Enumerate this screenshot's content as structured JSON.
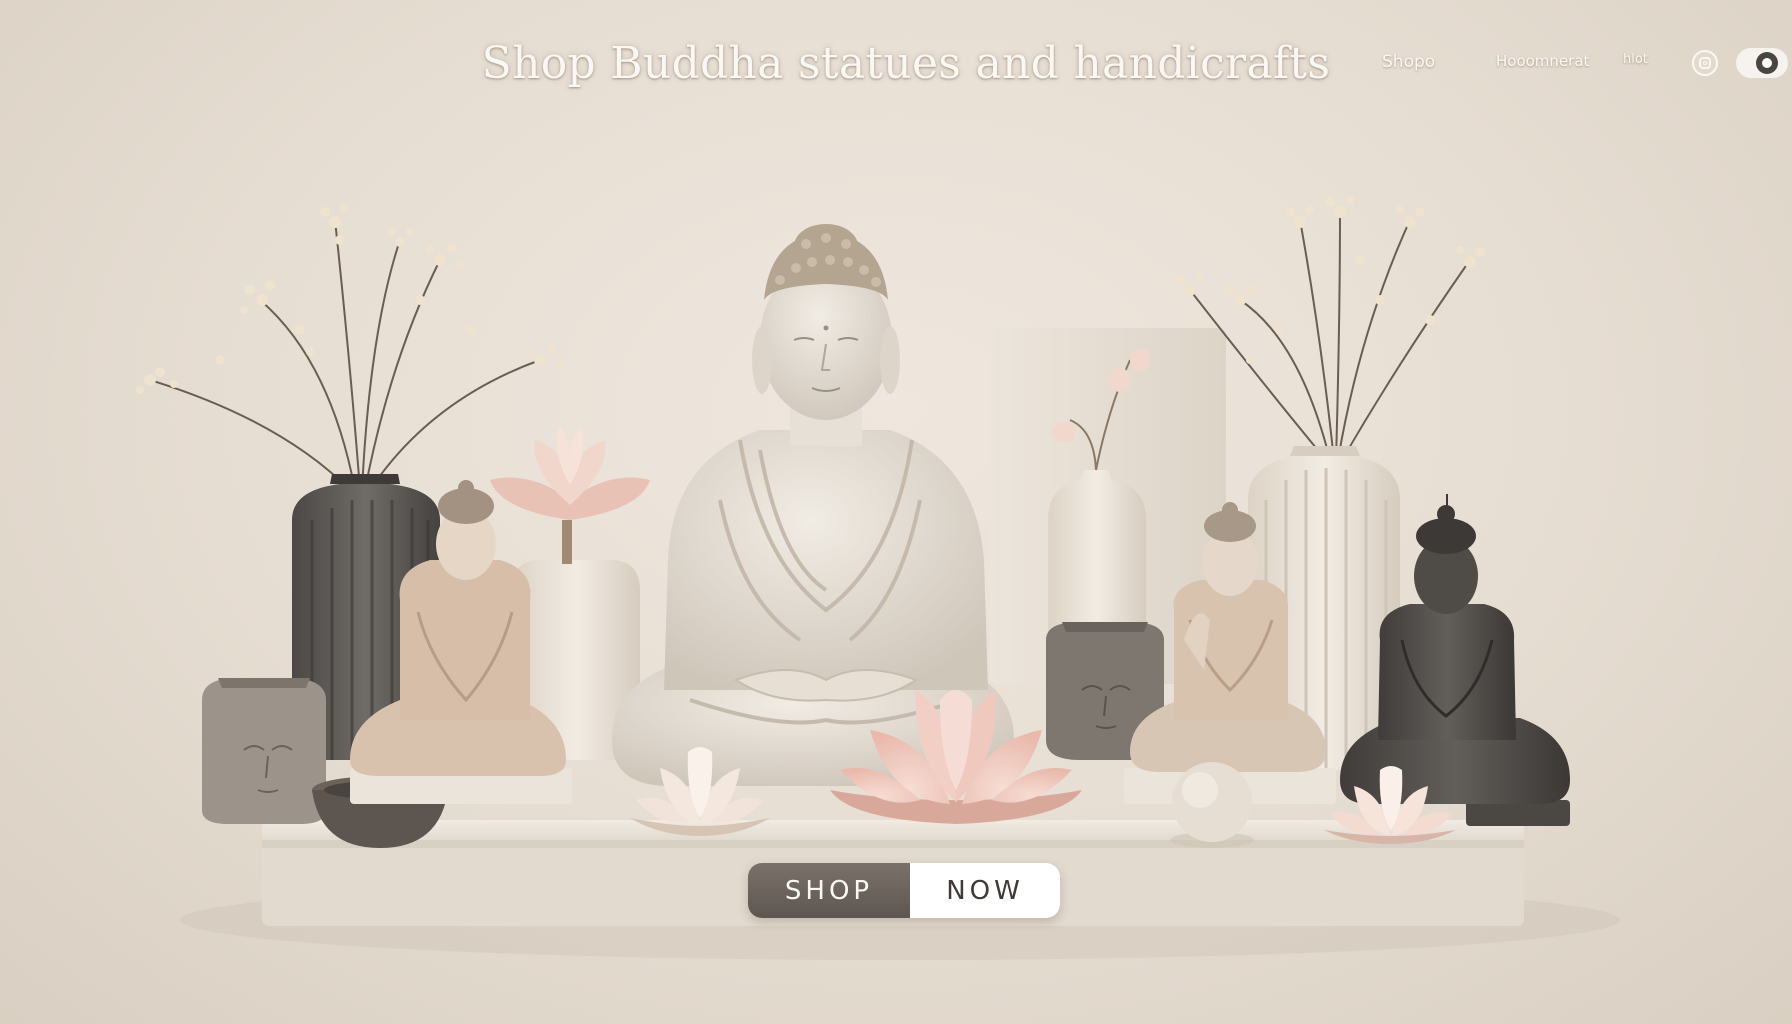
{
  "header": {
    "title": "Shop Buddha statues and handicrafts"
  },
  "nav": {
    "items": [
      {
        "label": "Shopo"
      },
      {
        "label": "Hooomnerat"
      },
      {
        "label": "hlot"
      }
    ],
    "icons": [
      "instagram-icon",
      "toggle-switch"
    ]
  },
  "cta": {
    "left_label": "SHOP",
    "right_label": "NOW"
  },
  "colors": {
    "background": "#e6ddd2",
    "cta_dark": "#6b635c",
    "cta_light": "#ffffff",
    "lotus_pink": "#f2cfc3",
    "stone_light": "#e3dbd0",
    "stone_dark": "#4e4a46"
  }
}
